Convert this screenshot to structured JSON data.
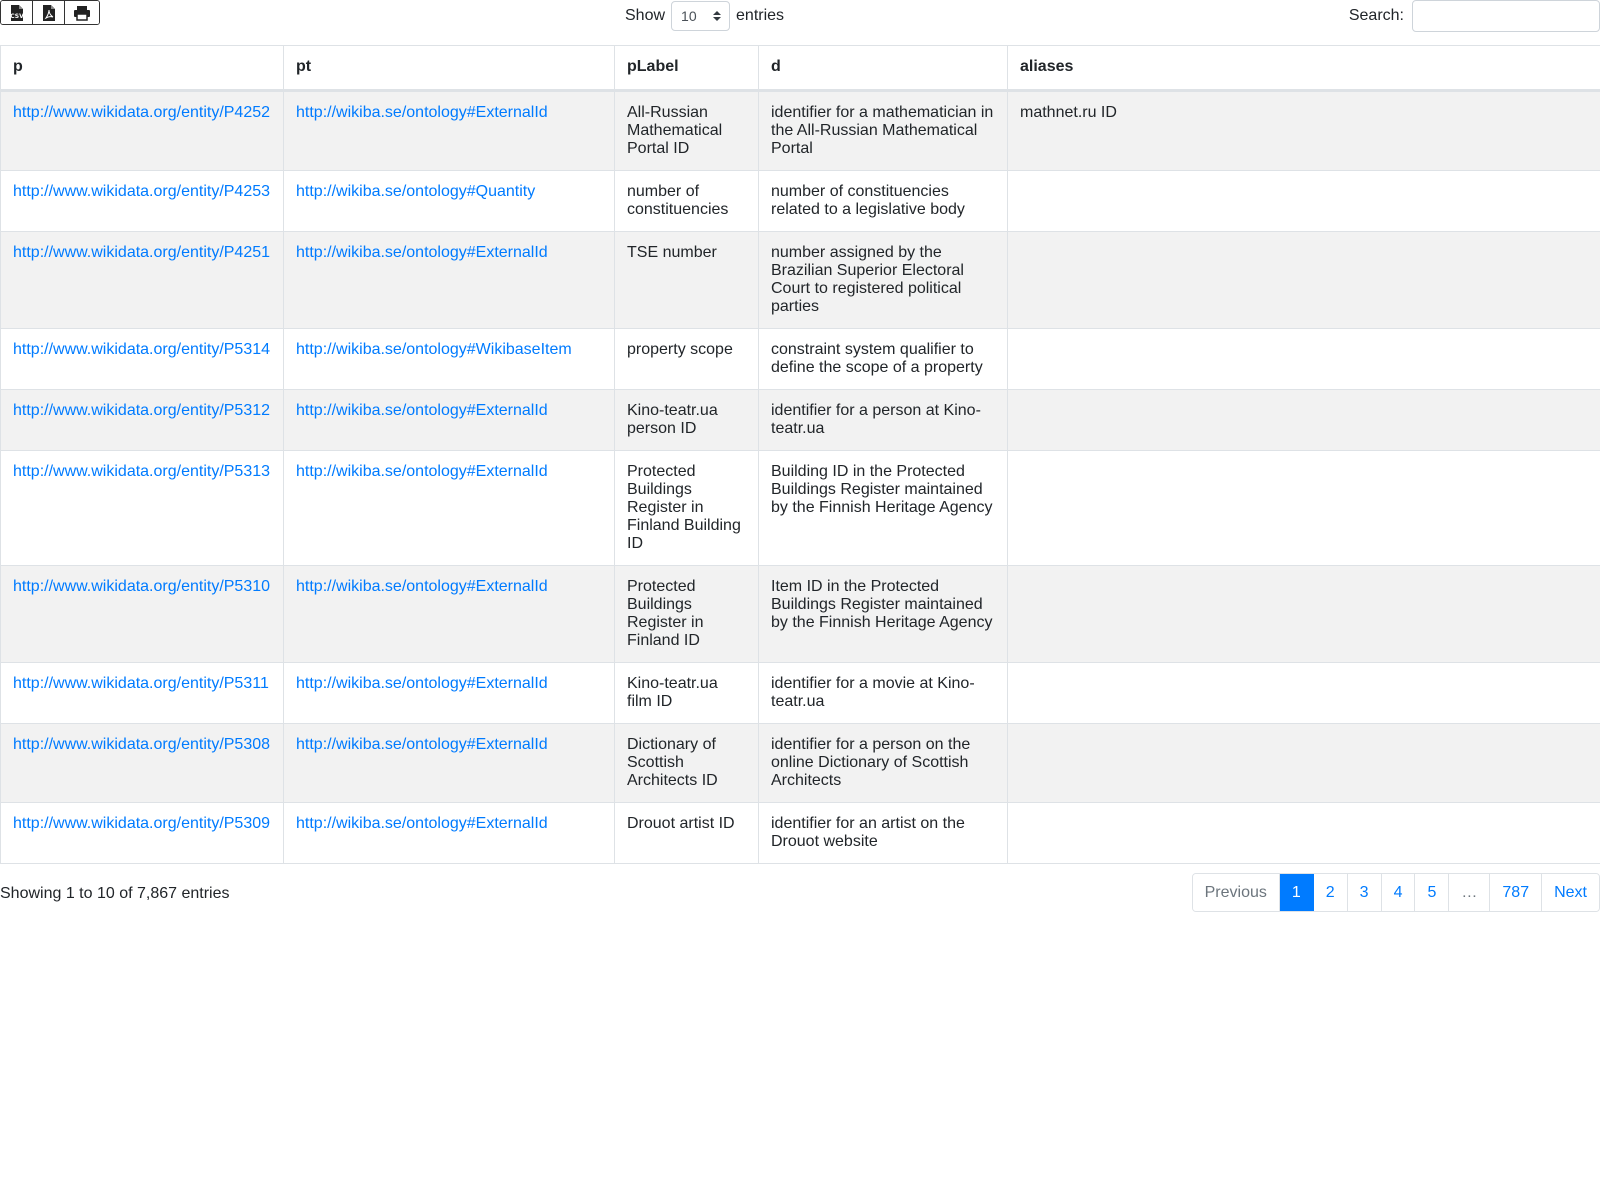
{
  "toolbar": {
    "export_buttons": [
      {
        "icon": "csv-file-icon",
        "label": "CSV"
      },
      {
        "icon": "pdf-file-icon"
      },
      {
        "icon": "print-icon"
      }
    ]
  },
  "length": {
    "show_label": "Show",
    "value": "10",
    "entries_label": "entries"
  },
  "search": {
    "label": "Search:",
    "value": ""
  },
  "table": {
    "columns": [
      "p",
      "pt",
      "pLabel",
      "d",
      "aliases"
    ],
    "rows": [
      {
        "p": "http://www.wikidata.org/entity/P4252",
        "pt": "http://wikiba.se/ontology#ExternalId",
        "pLabel": "All-Russian Mathematical Portal ID",
        "d": "identifier for a mathematician in the All-Russian Mathematical Portal",
        "aliases": "mathnet.ru ID"
      },
      {
        "p": "http://www.wikidata.org/entity/P4253",
        "pt": "http://wikiba.se/ontology#Quantity",
        "pLabel": "number of constituencies",
        "d": "number of constituencies related to a legislative body",
        "aliases": ""
      },
      {
        "p": "http://www.wikidata.org/entity/P4251",
        "pt": "http://wikiba.se/ontology#ExternalId",
        "pLabel": "TSE number",
        "d": "number assigned by the Brazilian Superior Electoral Court to registered political parties",
        "aliases": ""
      },
      {
        "p": "http://www.wikidata.org/entity/P5314",
        "pt": "http://wikiba.se/ontology#WikibaseItem",
        "pLabel": "property scope",
        "d": "constraint system qualifier to define the scope of a property",
        "aliases": ""
      },
      {
        "p": "http://www.wikidata.org/entity/P5312",
        "pt": "http://wikiba.se/ontology#ExternalId",
        "pLabel": "Kino-teatr.ua person ID",
        "d": "identifier for a person at Kino-teatr.ua",
        "aliases": ""
      },
      {
        "p": "http://www.wikidata.org/entity/P5313",
        "pt": "http://wikiba.se/ontology#ExternalId",
        "pLabel": "Protected Buildings Register in Finland Building ID",
        "d": "Building ID in the Protected Buildings Register maintained by the Finnish Heritage Agency",
        "aliases": ""
      },
      {
        "p": "http://www.wikidata.org/entity/P5310",
        "pt": "http://wikiba.se/ontology#ExternalId",
        "pLabel": "Protected Buildings Register in Finland ID",
        "d": "Item ID in the Protected Buildings Register maintained by the Finnish Heritage Agency",
        "aliases": ""
      },
      {
        "p": "http://www.wikidata.org/entity/P5311",
        "pt": "http://wikiba.se/ontology#ExternalId",
        "pLabel": "Kino-teatr.ua film ID",
        "d": "identifier for a movie at Kino-teatr.ua",
        "aliases": ""
      },
      {
        "p": "http://www.wikidata.org/entity/P5308",
        "pt": "http://wikiba.se/ontology#ExternalId",
        "pLabel": "Dictionary of Scottish Architects ID",
        "d": "identifier for a person on the online Dictionary of Scottish Architects",
        "aliases": ""
      },
      {
        "p": "http://www.wikidata.org/entity/P5309",
        "pt": "http://wikiba.se/ontology#ExternalId",
        "pLabel": "Drouot artist ID",
        "d": "identifier for an artist on the Drouot website",
        "aliases": ""
      }
    ]
  },
  "footer": {
    "info": "Showing 1 to 10 of 7,867 entries",
    "pages": [
      {
        "label": "Previous",
        "state": "disabled"
      },
      {
        "label": "1",
        "state": "active"
      },
      {
        "label": "2",
        "state": ""
      },
      {
        "label": "3",
        "state": ""
      },
      {
        "label": "4",
        "state": ""
      },
      {
        "label": "5",
        "state": ""
      },
      {
        "label": "…",
        "state": "disabled"
      },
      {
        "label": "787",
        "state": ""
      },
      {
        "label": "Next",
        "state": ""
      }
    ]
  },
  "colors": {
    "link": "#007bff",
    "active_page_bg": "#007bff",
    "stripe": "#f2f2f2"
  }
}
